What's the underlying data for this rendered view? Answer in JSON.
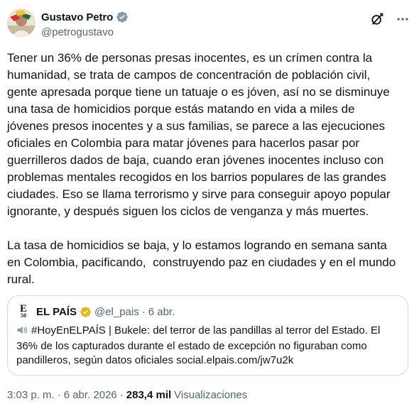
{
  "author": {
    "name": "Gustavo Petro",
    "handle": "@petrogustavo"
  },
  "tweet": {
    "text": "Tener un 36% de personas presas inocentes, es un crímen contra la\nhumanidad, se trata de campos de concentración de población civil,\ngente apresada porque tiene un tatuaje o es jóven, así no se disminuye\nuna tasa de homicidios porque estás matando en vida a miles de\njóvenes presos inocentes y a sus familias, se parece a las ejecuciones\noficiales en Colombia para matar jóvenes para hacerlos pasar por\nguerrilleros dados de baja, cuando eran jóvenes inocentes incluso con\nproblemas mentales recogidos en los barrios populares de las grandes\nciudades. Eso se llama terrorismo y sirve para conseguir apoyo popular\nignorante, y después siguen los ciclos de venganza y más muertes.\n\nLa tasa de homicidios se baja, y lo estamos logrando en semana santa\nen Colombia, pacificando,  construyendo paz en ciudades y en el mundo\nrural."
  },
  "quoted": {
    "logo_text_top": "E",
    "logo_text_bottom": "50",
    "name": "EL PAÍS",
    "handle": "@el_pais",
    "separator": "·",
    "date": "6 abr.",
    "text": "#HoyEnELPAÍS | Bukele: del terror de las pandillas al terror del Estado. El\n36% de los capturados durante el estado de excepción no figuraban como\npandilleros, según datos oficiales social.elpais.com/jw7u2k"
  },
  "meta": {
    "time": "3:03 p. m.",
    "separator": "·",
    "date": "6 abr. 2026",
    "views_count": "283,4 mil",
    "views_label": "Visualizaciones"
  },
  "icons": {
    "verified": "verified-badge-icon",
    "quoted_verified": "gold-verified-badge-icon",
    "grok": "grok-icon",
    "more": "more-icon",
    "speaker": "speaker-icon"
  },
  "colors": {
    "verified_blue": "#1d9bf0",
    "gold_badge": "#e2b719",
    "secondary_text": "#536471",
    "border": "#cfd9de"
  }
}
